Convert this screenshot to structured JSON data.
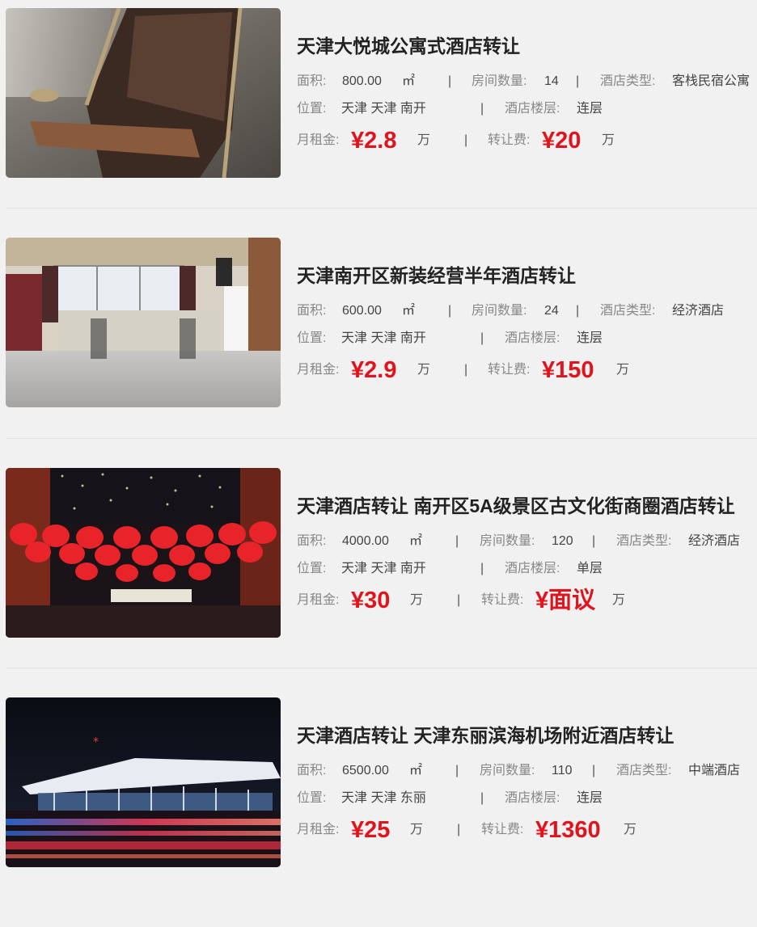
{
  "labels": {
    "area": "面积:",
    "rooms": "房间数量:",
    "type": "酒店类型:",
    "location": "位置:",
    "floors": "酒店楼层:",
    "rent": "月租金:",
    "fee": "转让费:",
    "sqm": "㎡",
    "wan": "万",
    "sep": "|"
  },
  "listings": [
    {
      "title": "天津大悦城公寓式酒店转让",
      "area": "800.00",
      "rooms": "14",
      "hotel_type": "客栈民宿公寓",
      "location": "天津 天津 南开",
      "floors": "连层",
      "rent": "¥2.8",
      "fee": "¥20"
    },
    {
      "title": "天津南开区新装经营半年酒店转让",
      "area": "600.00",
      "rooms": "24",
      "hotel_type": "经济酒店",
      "location": "天津 天津 南开",
      "floors": "连层",
      "rent": "¥2.9",
      "fee": "¥150"
    },
    {
      "title": "天津酒店转让 南开区5A级景区古文化街商圈酒店转让",
      "area": "4000.00",
      "rooms": "120",
      "hotel_type": "经济酒店",
      "location": "天津 天津 南开",
      "floors": "单层",
      "rent": "¥30",
      "fee": "¥面议"
    },
    {
      "title": "天津酒店转让 天津东丽滨海机场附近酒店转让",
      "area": "6500.00",
      "rooms": "110",
      "hotel_type": "中端酒店",
      "location": "天津 天津 东丽",
      "floors": "连层",
      "rent": "¥25",
      "fee": "¥1360"
    }
  ]
}
